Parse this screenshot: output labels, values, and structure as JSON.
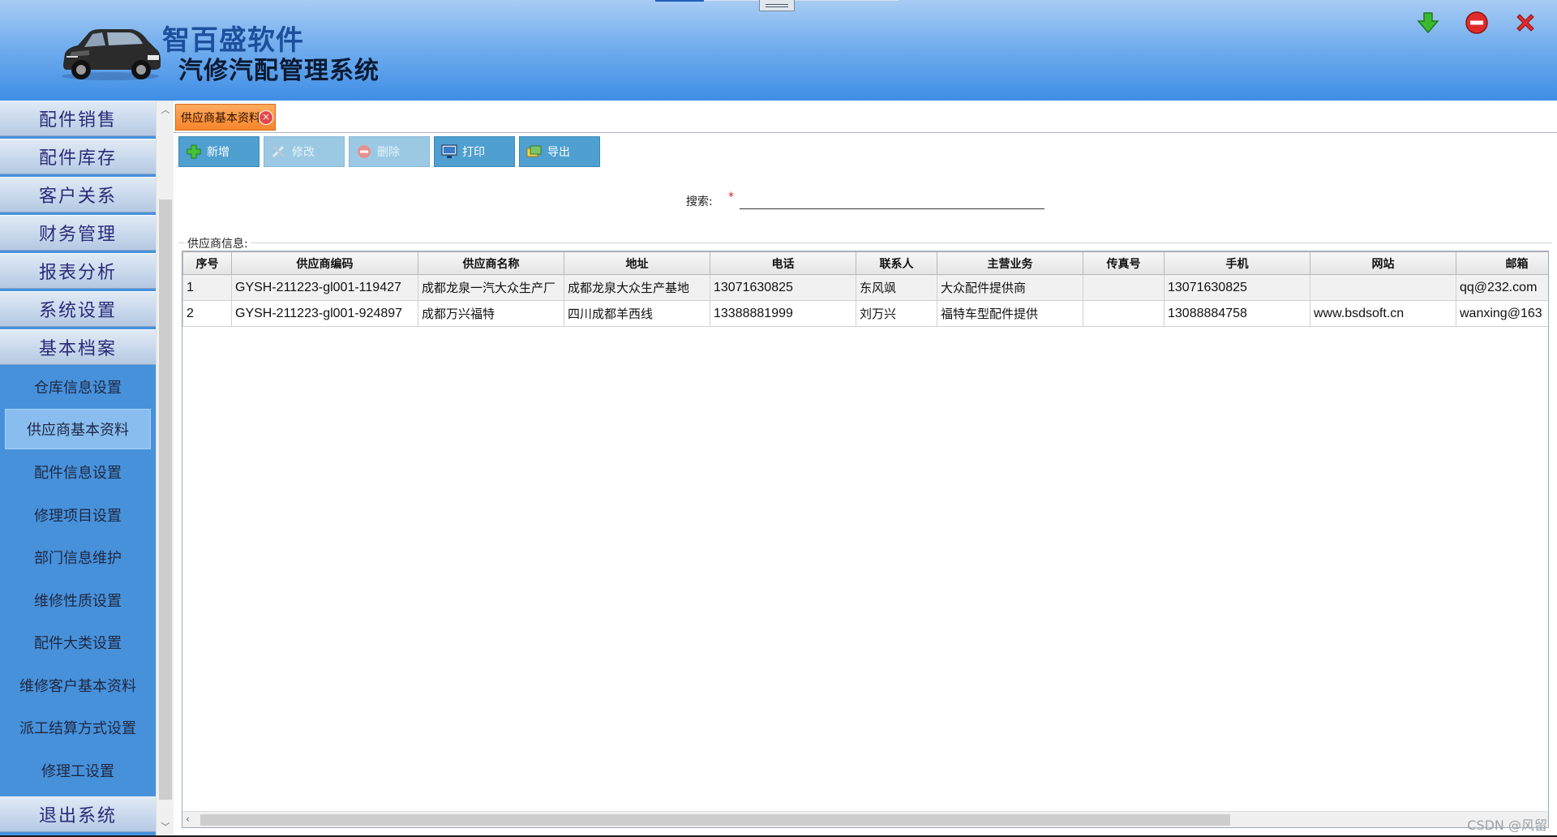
{
  "header": {
    "app_name": "智百盛软件",
    "app_subtitle": "汽修汽配管理系统",
    "window_buttons": [
      {
        "icon": "download-arrow-icon",
        "color": "#3cb832"
      },
      {
        "icon": "stop-icon",
        "color": "#e02b2b"
      },
      {
        "icon": "close-x-icon",
        "color": "#e02b2b"
      }
    ]
  },
  "sidebar": {
    "sections": [
      {
        "label": "配件销售"
      },
      {
        "label": "配件库存"
      },
      {
        "label": "客户关系"
      },
      {
        "label": "财务管理"
      },
      {
        "label": "报表分析"
      },
      {
        "label": "系统设置"
      },
      {
        "label": "基本档案"
      }
    ],
    "sub_items": [
      {
        "label": "仓库信息设置"
      },
      {
        "label": "供应商基本资料",
        "active": true
      },
      {
        "label": "配件信息设置"
      },
      {
        "label": "修理项目设置"
      },
      {
        "label": "部门信息维护"
      },
      {
        "label": "维修性质设置"
      },
      {
        "label": "配件大类设置"
      },
      {
        "label": "维修客户基本资料"
      },
      {
        "label": "派工结算方式设置"
      },
      {
        "label": "修理工设置"
      }
    ],
    "exit_label": "退出系统"
  },
  "tabs": {
    "active_label": "供应商基本资料",
    "close_glyph": "×"
  },
  "toolbar": {
    "add_label": "新增",
    "edit_label": "修改",
    "delete_label": "删除",
    "print_label": "打印",
    "export_label": "导出"
  },
  "search": {
    "label": "搜索:",
    "required_mark": "*",
    "value": ""
  },
  "grid": {
    "group_label": "供应商信息:",
    "columns": [
      "序号",
      "供应商编码",
      "供应商名称",
      "地址",
      "电话",
      "联系人",
      "主营业务",
      "传真号",
      "手机",
      "网站",
      "邮箱"
    ],
    "rows": [
      [
        "1",
        "GYSH-211223-gl001-119427",
        "成都龙泉一汽大众生产厂",
        "成都龙泉大众生产基地",
        "13071630825",
        "东风飒",
        "大众配件提供商",
        "",
        "13071630825",
        "",
        "qq@232.com"
      ],
      [
        "2",
        "GYSH-211223-gl001-924897",
        "成都万兴福特",
        "四川成都羊西线",
        "13388881999",
        "刘万兴",
        "福特车型配件提供",
        "",
        "13088884758",
        "www.bsdsoft.cn",
        "wanxing@163"
      ]
    ]
  },
  "watermark": "CSDN @风留",
  "colors": {
    "header_top": "#a9ccf3",
    "header_bottom": "#3f8ee6",
    "sidebar_bg": "#4791db",
    "active_tab": "#f7852c",
    "toolbar_button": "#4f9fd0"
  }
}
